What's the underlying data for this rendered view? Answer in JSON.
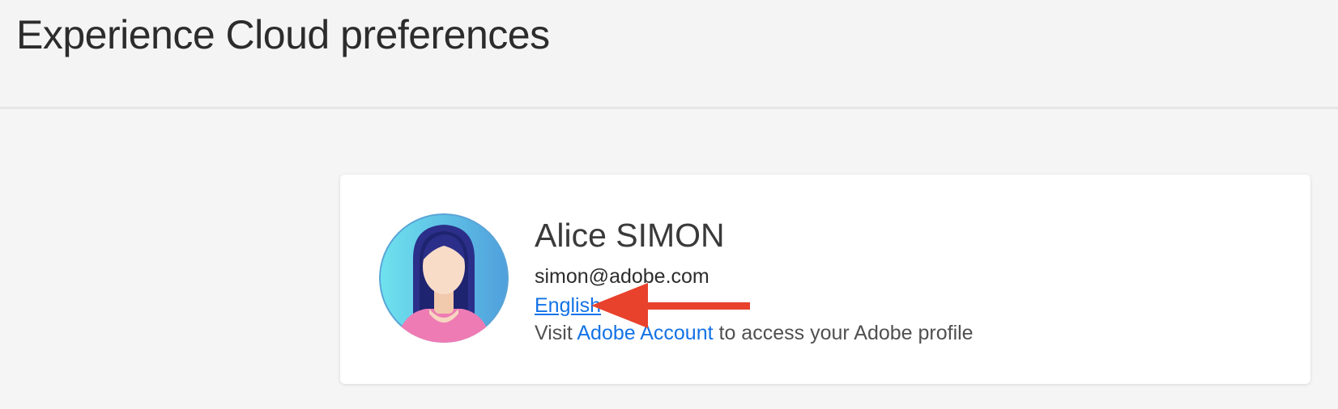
{
  "header": {
    "title": "Experience Cloud preferences"
  },
  "profile": {
    "name": "Alice SIMON",
    "email": "simon@adobe.com",
    "language": "English",
    "visit_prefix": "Visit",
    "account_link": "Adobe Account",
    "visit_suffix": "to access your Adobe profile",
    "avatar_icon": "user-avatar-icon"
  },
  "annotation": {
    "arrow_color": "#e8412c",
    "arrow_icon": "left-arrow-icon"
  },
  "colors": {
    "link": "#1473e6",
    "background": "#f5f5f5",
    "card": "#ffffff"
  }
}
